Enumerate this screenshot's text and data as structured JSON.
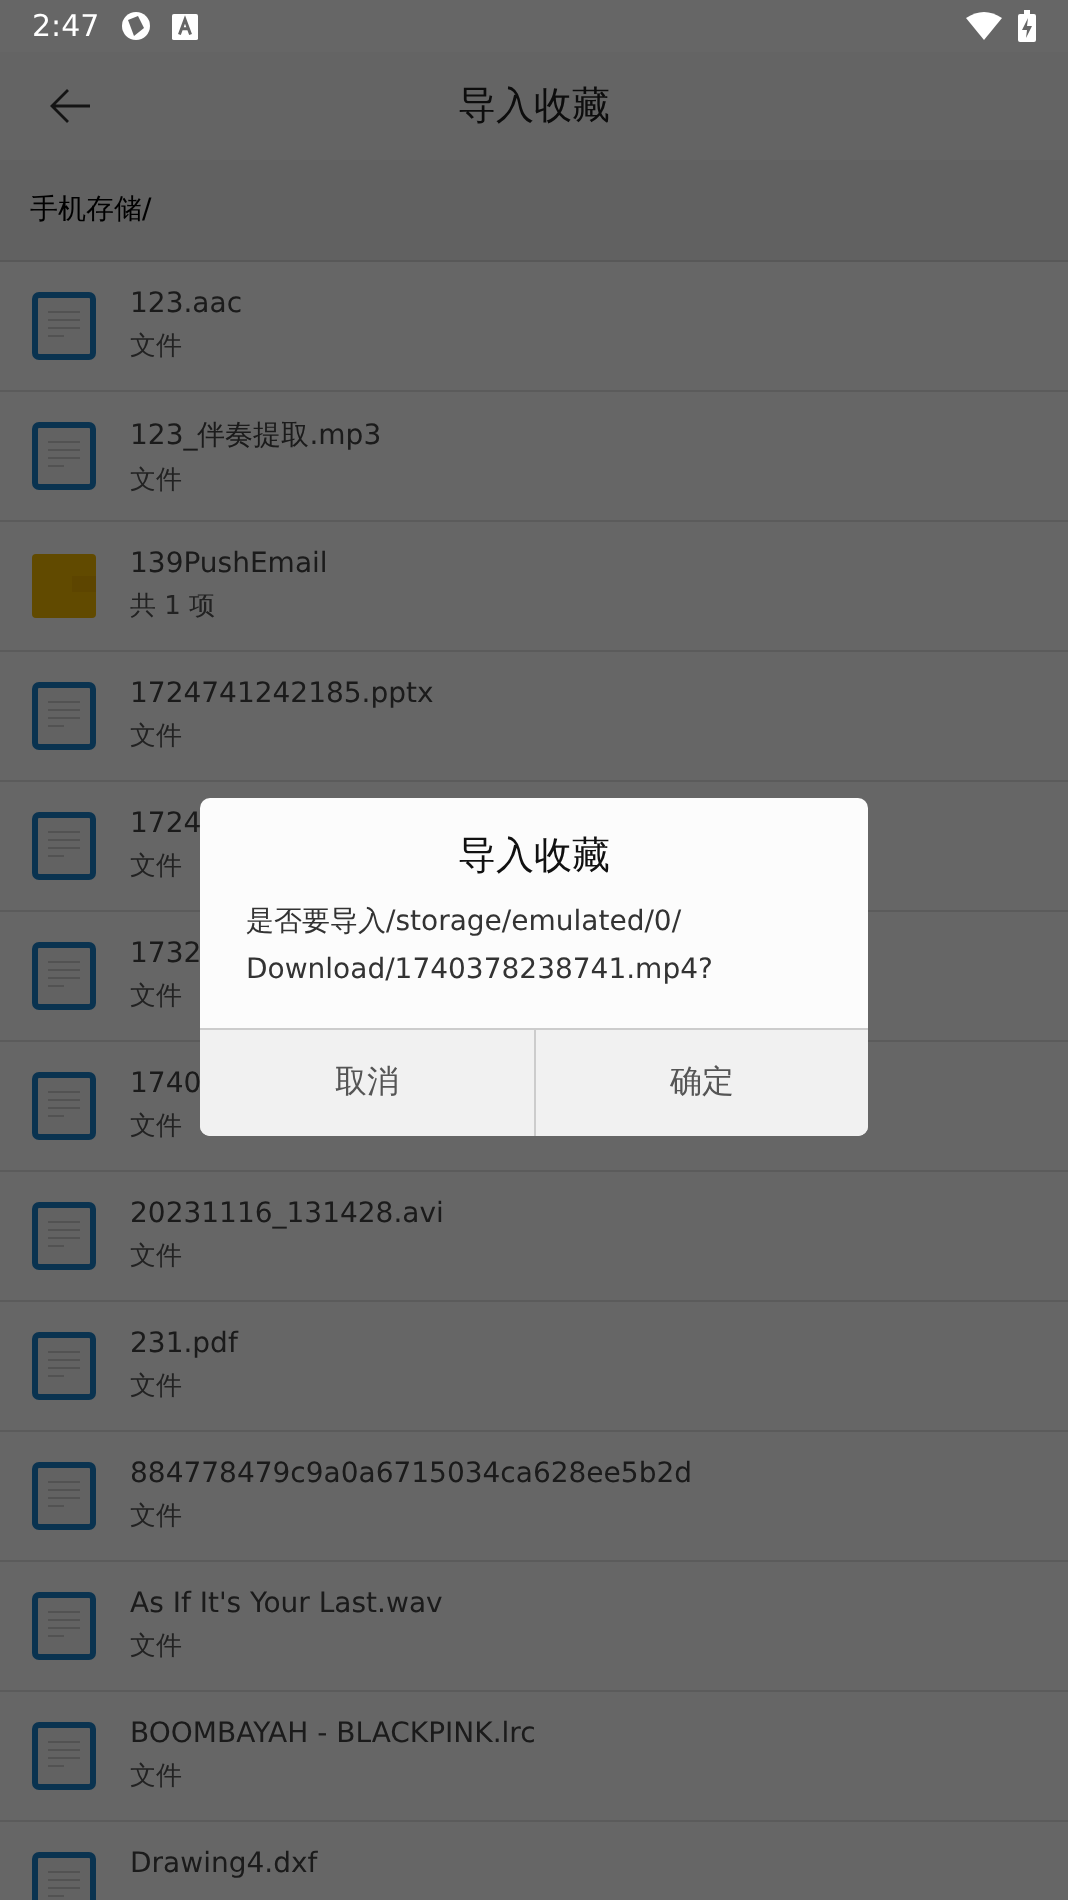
{
  "status_bar": {
    "time": "2:47"
  },
  "header": {
    "title": "导入收藏"
  },
  "path": "手机存储/",
  "items": [
    {
      "kind": "file",
      "name": "123.aac",
      "detail": "文件"
    },
    {
      "kind": "file",
      "name": "123_伴奏提取.mp3",
      "detail": "文件"
    },
    {
      "kind": "folder",
      "name": "139PushEmail",
      "detail": "共 1 项"
    },
    {
      "kind": "file",
      "name": "1724741242185.pptx",
      "detail": "文件"
    },
    {
      "kind": "file",
      "name": "1724",
      "detail": "文件"
    },
    {
      "kind": "file",
      "name": "1732",
      "detail": "文件"
    },
    {
      "kind": "file",
      "name": "1740",
      "detail": "文件"
    },
    {
      "kind": "file",
      "name": "20231116_131428.avi",
      "detail": "文件"
    },
    {
      "kind": "file",
      "name": "231.pdf",
      "detail": "文件"
    },
    {
      "kind": "file",
      "name": "884778479c9a0a6715034ca628ee5b2d",
      "detail": "文件"
    },
    {
      "kind": "file",
      "name": "As If It's Your Last.wav",
      "detail": "文件"
    },
    {
      "kind": "file",
      "name": "BOOMBAYAH - BLACKPINK.lrc",
      "detail": "文件"
    },
    {
      "kind": "file",
      "name": "Drawing4.dxf"
    }
  ],
  "dialog": {
    "title": "导入收藏",
    "message": "是否要导入/storage/emulated/0/ Download/1740378238741.mp4?",
    "buttons": [
      "取消",
      "确定"
    ]
  }
}
